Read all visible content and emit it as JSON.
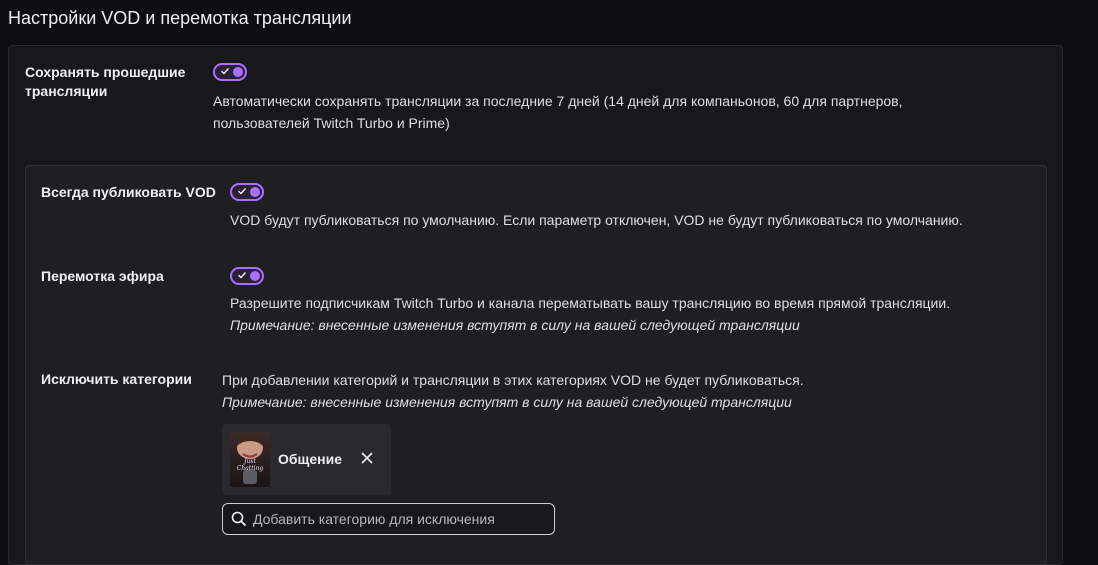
{
  "page": {
    "title": "Настройки VOD и перемотка трансляции"
  },
  "save_past": {
    "label": "Сохранять прошедшие трансляции",
    "enabled": true,
    "description_line1": "Автоматически сохранять трансляции за последние 7 дней (14 дней для компаньонов, 60 для партнеров,",
    "description_line2": "пользователей Twitch Turbo и Prime)"
  },
  "always_publish": {
    "label": "Всегда публиковать VOD",
    "enabled": true,
    "description": "VOD будут публиковаться по умолчанию. Если параметр отключен, VOD не будут публиковаться по умолчанию."
  },
  "rewind": {
    "label": "Перемотка эфира",
    "enabled": true,
    "description": "Разрешите подписчикам Twitch Turbo и канала перематывать вашу трансляцию во время прямой трансляции.",
    "note": "Примечание: внесенные изменения вступят в силу на вашей следующей трансляции"
  },
  "exclude_categories": {
    "label": "Исключить категории",
    "description": "При добавлении категорий и трансляции в этих категориях VOD не будет публиковаться.",
    "note": "Примечание: внесенные изменения вступят в силу на вашей следующей трансляции",
    "categories": [
      {
        "name": "Общение",
        "thumb_text_top": "Just",
        "thumb_text_bottom": "Chatting"
      }
    ],
    "search_placeholder": "Добавить категорию для исключения"
  },
  "colors": {
    "accent": "#a970ff",
    "background": "#0e0e10",
    "panel": "#18181b"
  },
  "icons": {
    "toggle_check": "check-icon",
    "remove": "close-icon",
    "search": "search-icon"
  }
}
